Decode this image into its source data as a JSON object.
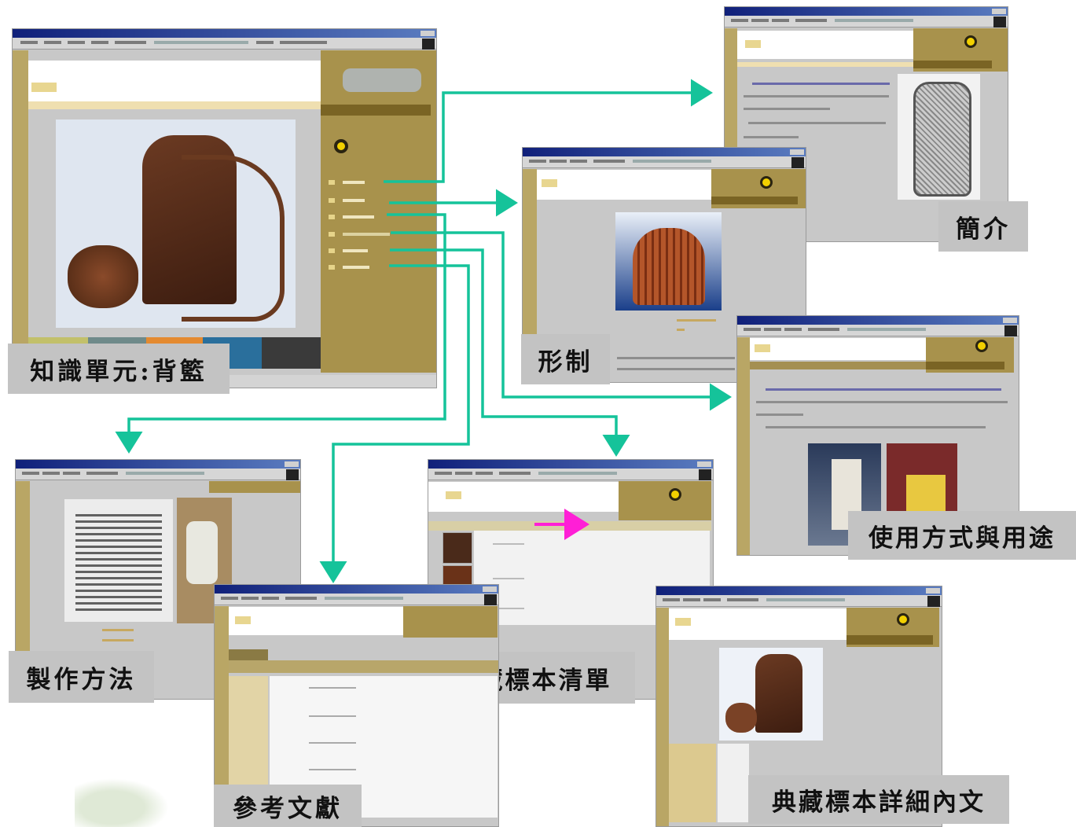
{
  "labels": {
    "knowledge_unit": "知識單元:背籃",
    "intro": "簡介",
    "form": "形制",
    "usage": "使用方式與用途",
    "making": "製作方法",
    "references": "參考文獻",
    "specimen_list": "典藏標本清單",
    "specimen_detail": "典藏標本詳細內文"
  },
  "colors": {
    "arrow": "#15c39a",
    "highlight_arrow": "#ff1fd6",
    "olive": "#a8924c",
    "label_bg": "#c3c3c3"
  },
  "icons": [
    "yellow-logo-icon",
    "window-controls-icon",
    "throbber-icon"
  ]
}
